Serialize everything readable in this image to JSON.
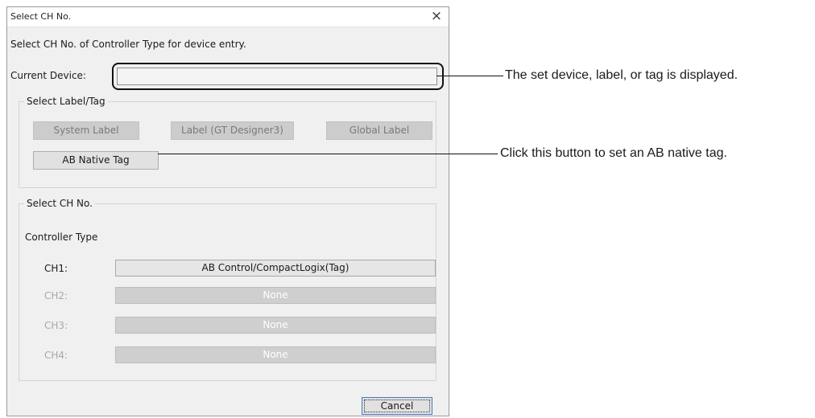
{
  "dialog": {
    "title": "Select CH No.",
    "close_glyph": "×",
    "instruction": "Select CH No. of Controller Type for device entry.",
    "current_device": {
      "label": "Current Device:",
      "value": ""
    },
    "label_tag_group": {
      "legend": "Select Label/Tag",
      "buttons": {
        "system_label": "System Label",
        "label_gt": "Label (GT Designer3)",
        "global_label": "Global Label",
        "ab_native_tag": "AB Native Tag"
      }
    },
    "ch_group": {
      "legend": "Select CH No.",
      "controller_type_label": "Controller Type",
      "channels": [
        {
          "label": "CH1:",
          "value": "AB Control/CompactLogix(Tag)",
          "enabled": true
        },
        {
          "label": "CH2:",
          "value": "None",
          "enabled": false
        },
        {
          "label": "CH3:",
          "value": "None",
          "enabled": false
        },
        {
          "label": "CH4:",
          "value": "None",
          "enabled": false
        }
      ]
    },
    "cancel_label": "Cancel"
  },
  "annotations": {
    "current_device_note": "The set device, label, or tag is displayed.",
    "ab_native_tag_note": "Click this button to set an AB native tag."
  }
}
